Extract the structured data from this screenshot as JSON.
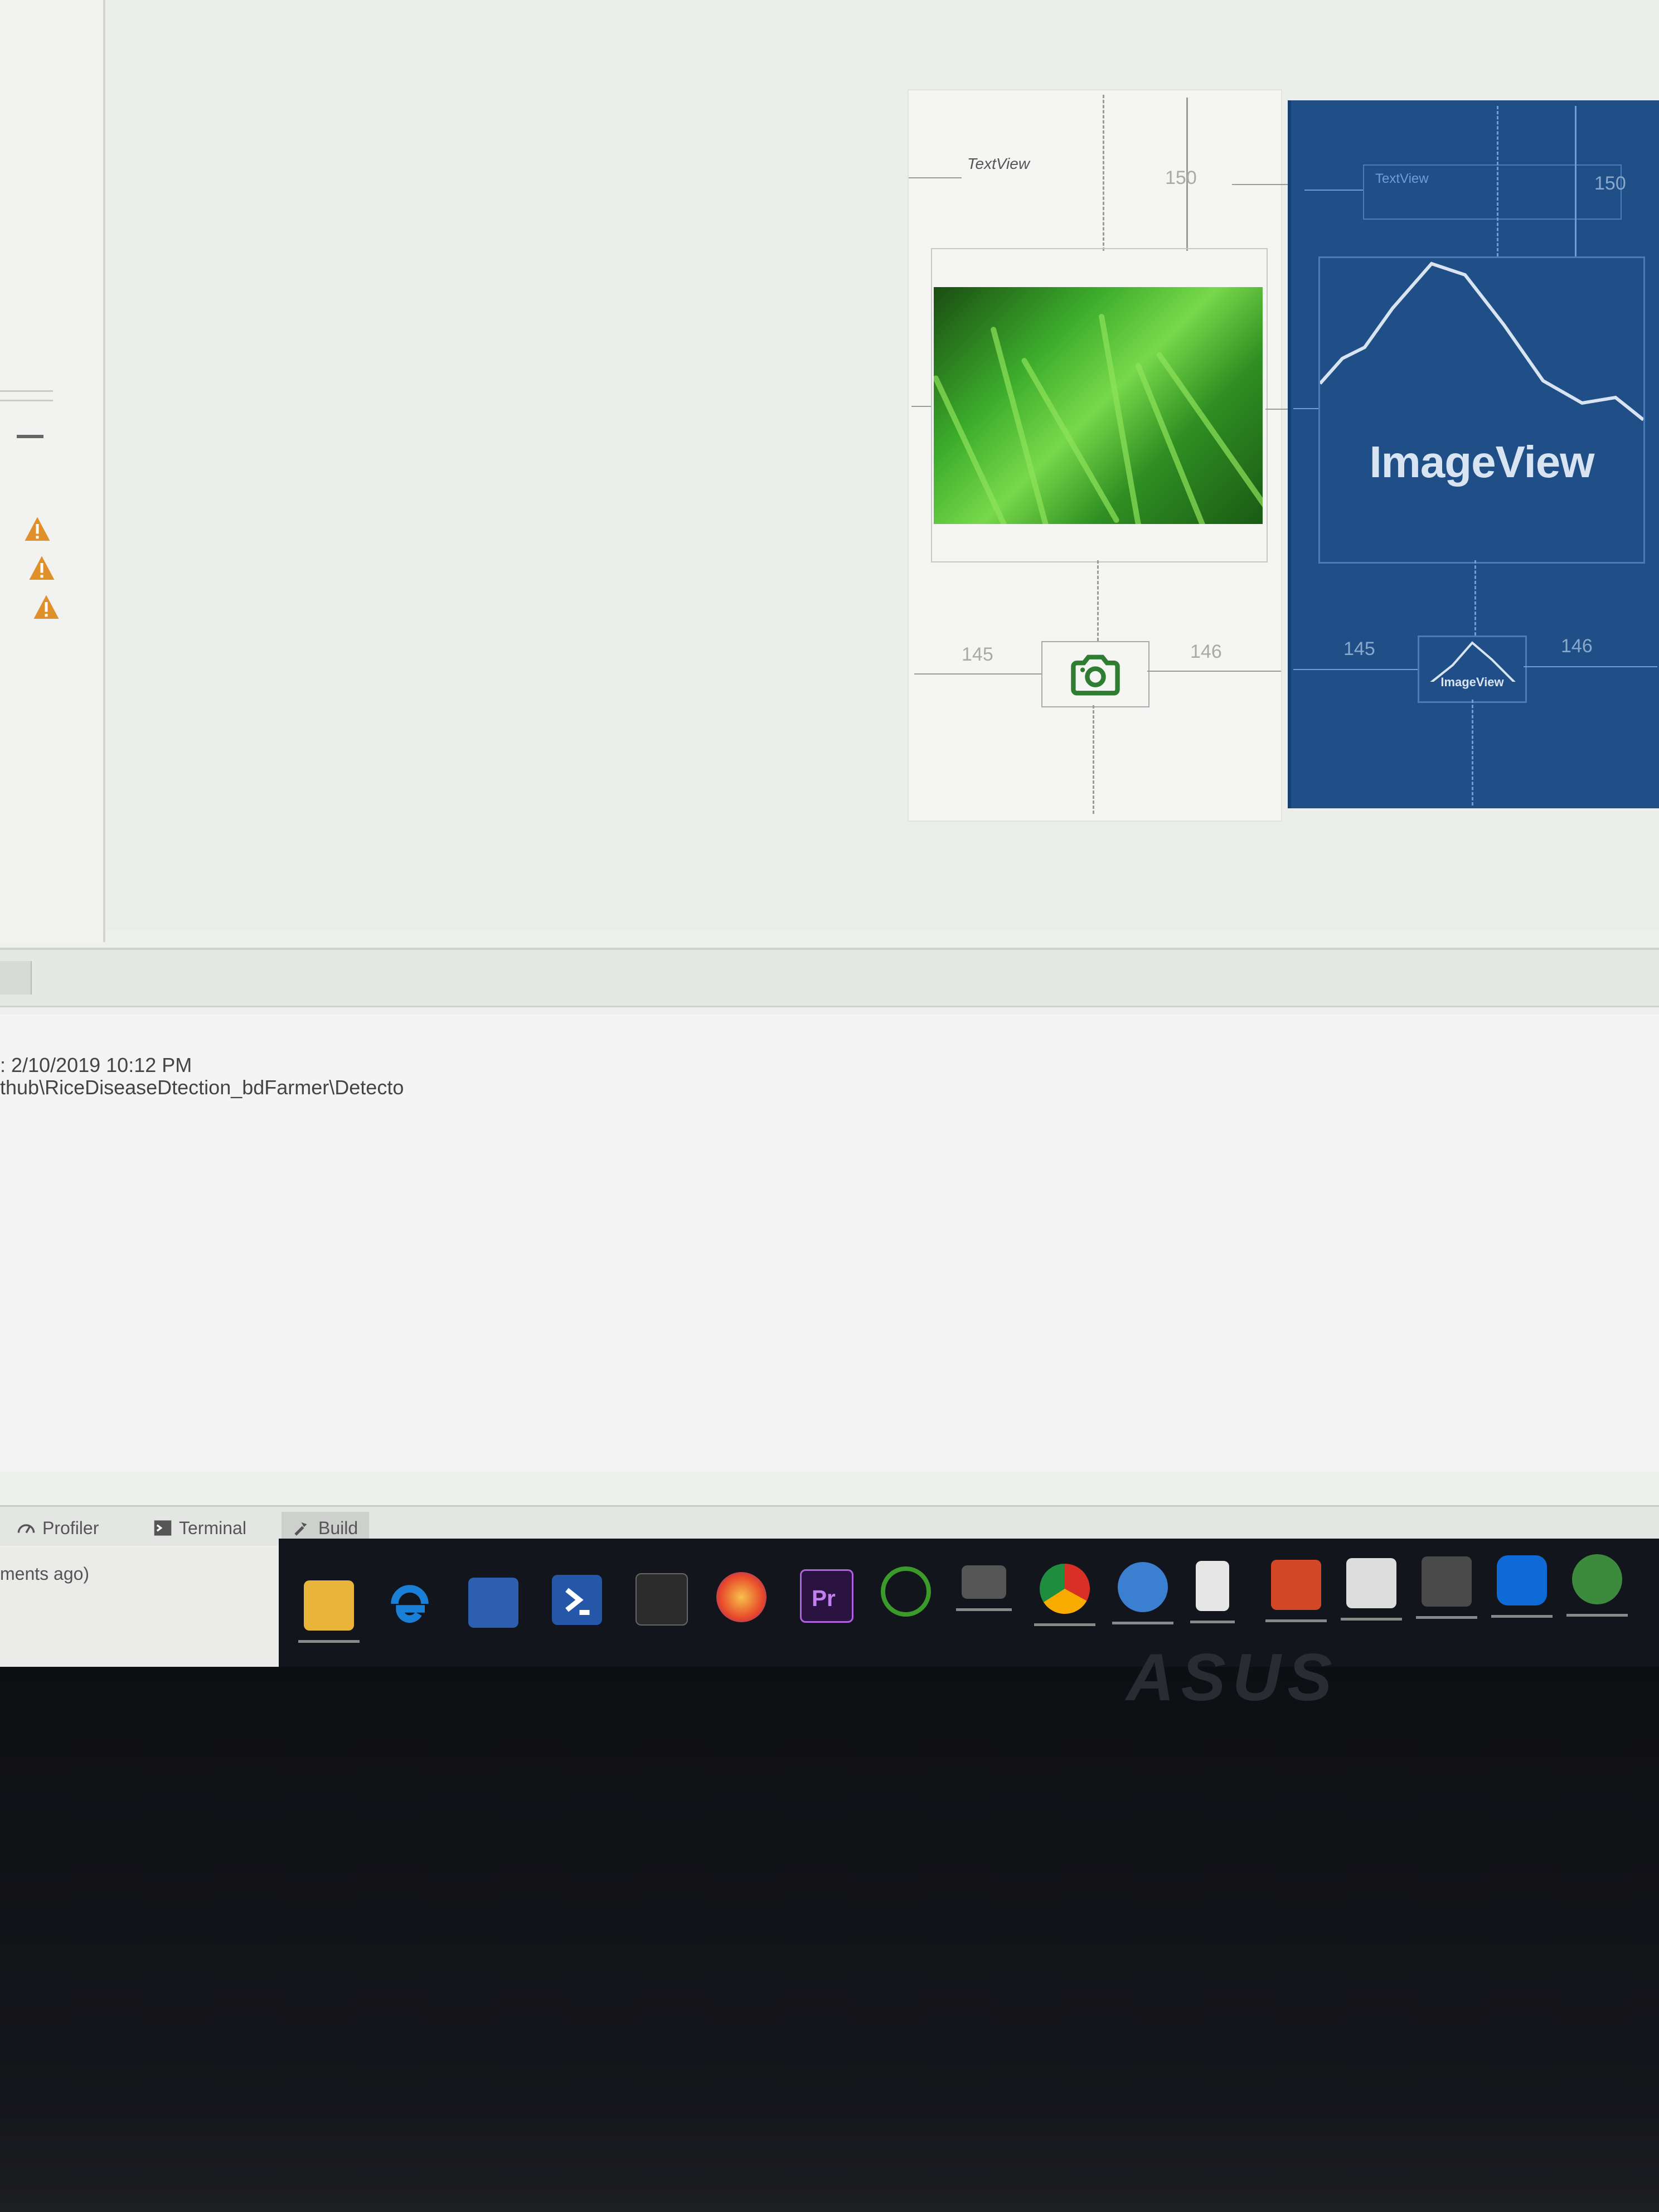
{
  "design": {
    "textview_label": "TextView",
    "dim_top": "150",
    "dim_left": "145",
    "dim_right": "146",
    "bp_textview_label": "TextView",
    "bp_dim_top": "150",
    "bp_dim_left": "145",
    "bp_dim_right": "146",
    "bp_imageview_label": "ImageView",
    "bp_small_label": "ImageView"
  },
  "log": {
    "line1": ": 2/10/2019 10:12 PM",
    "line2": "thub\\RiceDiseaseDtection_bdFarmer\\Detecto"
  },
  "tool_tabs": {
    "profiler": "Profiler",
    "terminal": "Terminal",
    "build": "Build"
  },
  "status": {
    "text": "ments ago)"
  },
  "icons": [
    "folder-icon",
    "edge-icon",
    "chat-icon",
    "powershell-icon",
    "cmd-icon",
    "firefox-icon",
    "premiere-icon",
    "spinner-app-icon",
    "window-icon",
    "chrome-icon",
    "db-icon",
    "file-icon",
    "powerpoint-icon",
    "photos-icon",
    "sublime-icon",
    "teamviewer-icon",
    "android-studio-icon"
  ],
  "colors": {
    "blueprint": "#1f4f86",
    "warning": "#e0902a",
    "camera": "#2e7d32"
  },
  "bezel": {
    "brand": "ASUS"
  }
}
